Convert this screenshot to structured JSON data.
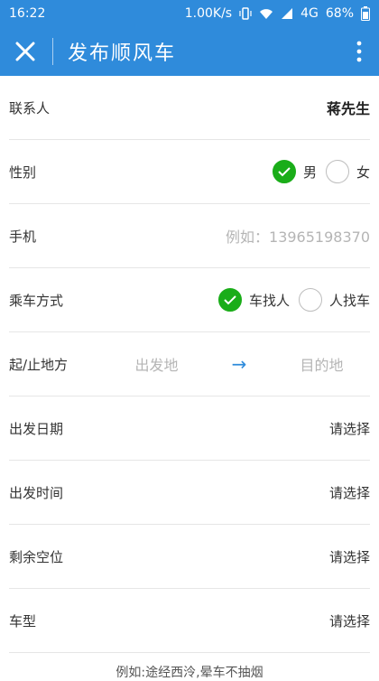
{
  "status_bar": {
    "time": "16:22",
    "speed": "1.00K/s",
    "network": "4G",
    "battery": "68%"
  },
  "app_bar": {
    "title": "发布顺风车"
  },
  "form": {
    "contact_label": "联系人",
    "contact_value": "蒋先生",
    "gender_label": "性别",
    "gender_options": [
      "男",
      "女"
    ],
    "phone_label": "手机",
    "phone_placeholder": "例如：13965198370",
    "ride_label": "乘车方式",
    "ride_options": [
      "车找人",
      "人找车"
    ],
    "route_label": "起/止地方",
    "origin_placeholder": "出发地",
    "destination_placeholder": "目的地",
    "date_label": "出发日期",
    "date_value": "请选择",
    "time_label": "出发时间",
    "time_value": "请选择",
    "seats_label": "剩余空位",
    "seats_value": "请选择",
    "car_label": "车型",
    "car_value": "请选择"
  },
  "colors": {
    "primary": "#2f8bdb",
    "accent_green": "#1aad19"
  },
  "hint": "例如:途经西泠,晕车不抽烟"
}
